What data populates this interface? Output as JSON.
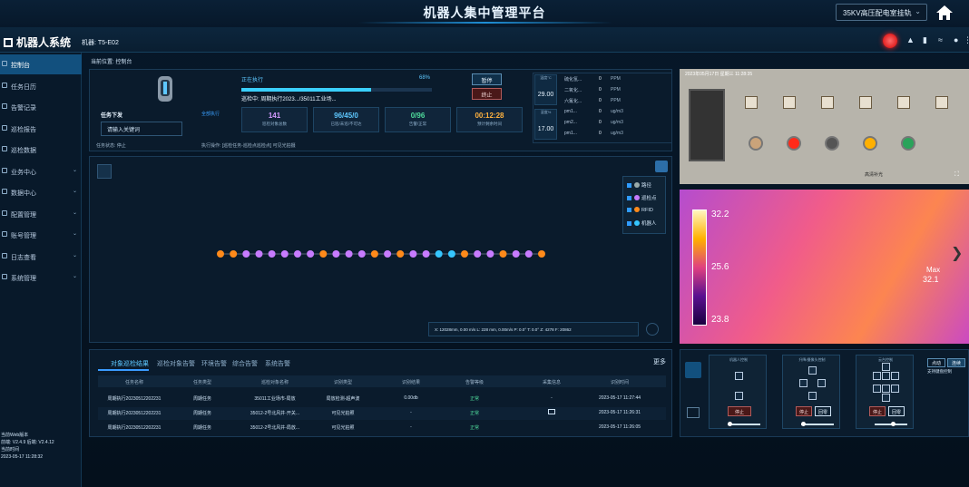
{
  "header": {
    "title": "机器人集中管理平台",
    "station": "35KV高压配电室挂轨"
  },
  "subbar": {
    "brand": "机器人系统",
    "robot_label": "机器: T5-E02"
  },
  "sidebar": {
    "items": [
      {
        "label": "控制台",
        "active": true
      },
      {
        "label": "任务日历"
      },
      {
        "label": "告警记录"
      },
      {
        "label": "巡检报告"
      },
      {
        "label": "巡检数据"
      },
      {
        "label": "业务中心",
        "arrow": true
      },
      {
        "label": "数据中心",
        "arrow": true
      },
      {
        "label": "配置管理",
        "arrow": true
      },
      {
        "label": "账号管理",
        "arrow": true
      },
      {
        "label": "日志查看",
        "arrow": true
      },
      {
        "label": "系统管理",
        "arrow": true
      }
    ],
    "footer": {
      "line1": "当前Web版本",
      "line2": "前端: V2.4.9 后端: V2.4.12",
      "line3": "当前时间",
      "line4": "2023-05-17 11:28:32"
    }
  },
  "breadcrumb": "当前位置: 控制台",
  "task": {
    "dispatch_label": "任务下发",
    "all_label": "全部执行",
    "keyword_placeholder": "请输入关键词",
    "run_state": "正在执行",
    "progress_text": "68%",
    "progress": 0.68,
    "patrol_name": "巡检中: 周期执行2023.../35011工业场...",
    "pause_label": "暂停",
    "stop_label": "终止",
    "stats": [
      {
        "value": "141",
        "label": "巡检对象总数",
        "color": "#d49bff"
      },
      {
        "value": "96/45/0",
        "label": "已巡/未巡/不可达",
        "color": "#5ec8ff"
      },
      {
        "value": "0/96",
        "label": "告警/正常",
        "color": "#4fdc9c"
      },
      {
        "value": "00:12:28",
        "label": "预计剩余时间",
        "color": "#ffb23f"
      }
    ],
    "state_line": "任务状态: 停止",
    "exec_line": "执行操作: [巡检任务-巡检点巡检点] 可见光拍摄"
  },
  "sensors": {
    "cards": [
      {
        "label": "温度°C",
        "value": "29.00"
      },
      {
        "label": "湿度%",
        "value": "17.00"
      }
    ],
    "gases": [
      {
        "name": "硫化氢...",
        "value": "0",
        "unit": "PPM"
      },
      {
        "name": "二氧化...",
        "value": "0",
        "unit": "PPM"
      },
      {
        "name": "六氟化...",
        "value": "0",
        "unit": "PPM"
      },
      {
        "name": "pm1...",
        "value": "0",
        "unit": "ug/m3"
      },
      {
        "name": "pm2...",
        "value": "0",
        "unit": "ug/m3"
      },
      {
        "name": "pm1...",
        "value": "0",
        "unit": "ug/m3"
      }
    ]
  },
  "map": {
    "legend": [
      {
        "label": "路径",
        "color": "#9aa"
      },
      {
        "label": "巡检点",
        "color": "#c77bff"
      },
      {
        "label": "RFID",
        "color": "#ff8a1a"
      },
      {
        "label": "机器人",
        "color": "#35c6ff"
      }
    ],
    "coords": "X: 12028mm, 0.00 m/s   L: 228 mm, 0.00m/s   P: 0.0°   T: 0.0°   Z: 4278   F: 20862",
    "nodes": [
      {
        "t": "r"
      },
      {
        "t": "r"
      },
      {
        "t": "p"
      },
      {
        "t": "p"
      },
      {
        "t": "p"
      },
      {
        "t": "p"
      },
      {
        "t": "p"
      },
      {
        "t": "p"
      },
      {
        "t": "r"
      },
      {
        "t": "p"
      },
      {
        "t": "p"
      },
      {
        "t": "p"
      },
      {
        "t": "r"
      },
      {
        "t": "p"
      },
      {
        "t": "r"
      },
      {
        "t": "p"
      },
      {
        "t": "p"
      },
      {
        "t": "b"
      },
      {
        "t": "b"
      },
      {
        "t": "r"
      },
      {
        "t": "p"
      },
      {
        "t": "p"
      },
      {
        "t": "r"
      },
      {
        "t": "p"
      },
      {
        "t": "p"
      },
      {
        "t": "r"
      }
    ]
  },
  "table": {
    "tabs": [
      "对象巡检结果",
      "巡检对象告警",
      "环境告警",
      "综合告警",
      "系统告警"
    ],
    "more": "更多",
    "headers": [
      "任务名称",
      "任务类型",
      "巡检对象名称",
      "识别类型",
      "识别结果",
      "告警等级",
      "采集信息",
      "识别时间"
    ],
    "rows": [
      [
        "周期执行20230512202231",
        "周期任务",
        "35011工业场市-局放",
        "局放检测-超声波",
        "0.00db",
        "正常",
        "-",
        "2023-05-17 11:27:44"
      ],
      [
        "周期执行20230512202231",
        "周期任务",
        "35012-2号北风井-开关...",
        "可见光拍照",
        "-",
        "正常",
        "img",
        "2023-05-17 11:26:31"
      ],
      [
        "周期执行20230512202231",
        "周期任务",
        "35012-2号北风井-局放...",
        "可见光拍照",
        "-",
        "正常",
        "",
        "2023-05-17 11:26:05"
      ]
    ]
  },
  "camera": {
    "ts": "2023年05月17日 星期三 11:28:35",
    "ir_max": "32.2",
    "ir_mid": "25.6",
    "ir_min": "23.8",
    "max_label": "Max",
    "max_val": "32.1",
    "vis_label": "高清补光"
  },
  "ptz": {
    "box1": "机器人控制",
    "box2": "升降/摄像头控制",
    "box3": "云台控制",
    "stop": "停止",
    "reset": "回零",
    "mode1": "点动",
    "mode2": "连续",
    "kbhint": "支持键盘控制"
  }
}
